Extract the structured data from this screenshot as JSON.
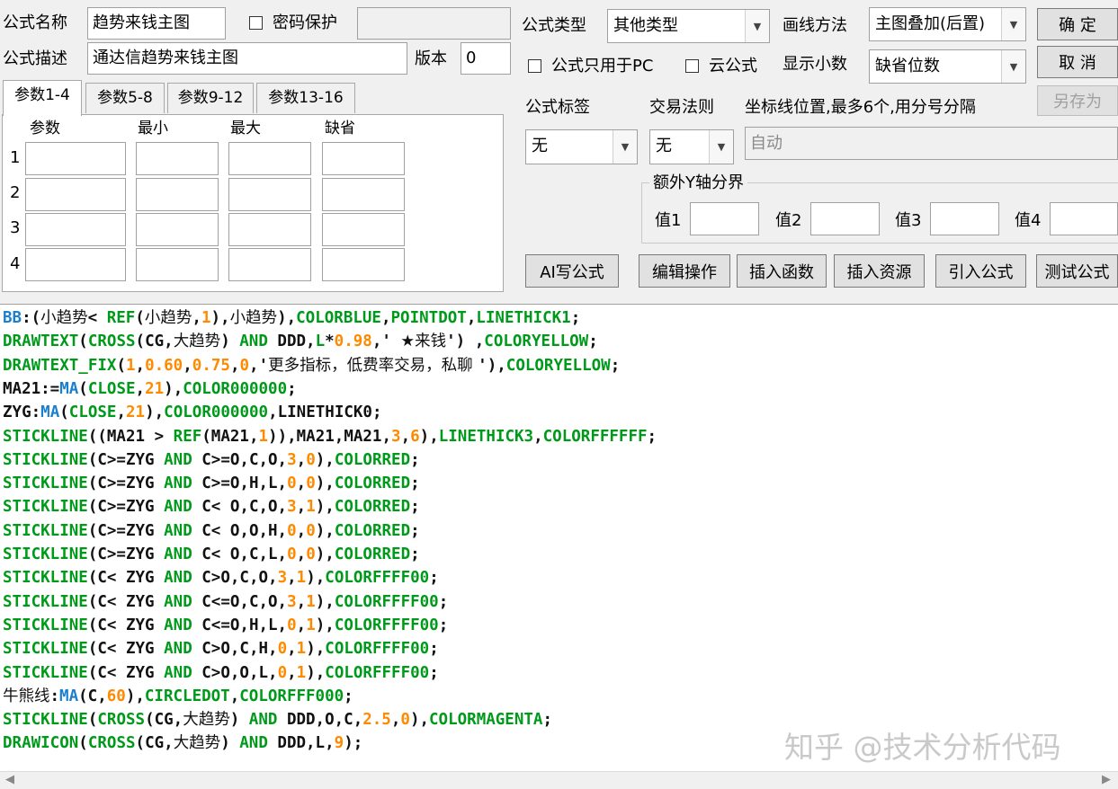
{
  "header": {
    "name_label": "公式名称",
    "name_value": "趋势来钱主图",
    "password_label": "密码保护",
    "desc_label": "公式描述",
    "desc_value": "通达信趋势来钱主图",
    "version_label": "版本",
    "version_value": "0",
    "type_label": "公式类型",
    "type_value": "其他类型",
    "draw_label": "画线方法",
    "draw_value": "主图叠加(后置)",
    "pc_only_label": "公式只用于PC",
    "cloud_label": "云公式",
    "decimal_label": "显示小数",
    "decimal_value": "缺省位数"
  },
  "buttons": {
    "ok": "确  定",
    "cancel": "取  消",
    "save_as": "另存为",
    "ai": "AI写公式",
    "edit": "编辑操作",
    "insert_func": "插入函数",
    "insert_res": "插入资源",
    "import": "引入公式",
    "test": "测试公式"
  },
  "tabs": [
    "参数1-4",
    "参数5-8",
    "参数9-12",
    "参数13-16"
  ],
  "params": {
    "headers": [
      "参数",
      "最小",
      "最大",
      "缺省"
    ],
    "rows": [
      "1",
      "2",
      "3",
      "4"
    ]
  },
  "tags": {
    "tag_label": "公式标签",
    "tag_value": "无",
    "trade_label": "交易法则",
    "trade_value": "无",
    "coord_label": "坐标线位置,最多6个,用分号分隔",
    "coord_value": "自动",
    "yaxis_group": "额外Y轴分界",
    "yvals": [
      "值1",
      "值2",
      "值3",
      "值4"
    ]
  },
  "watermark": "知乎 @技术分析代码",
  "code_lines": [
    [
      [
        "k-blue",
        "BB"
      ],
      [
        "k-black",
        ":("
      ],
      [
        "k-cn",
        "小趋势"
      ],
      [
        "k-black",
        "< "
      ],
      [
        "k-green",
        "REF"
      ],
      [
        "k-black",
        "("
      ],
      [
        "k-cn",
        "小趋势"
      ],
      [
        "k-black",
        ","
      ],
      [
        "k-orange",
        "1"
      ],
      [
        "k-black",
        "),"
      ],
      [
        "k-cn",
        "小趋势"
      ],
      [
        "k-black",
        "),"
      ],
      [
        "k-green",
        "COLORBLUE"
      ],
      [
        "k-black",
        ","
      ],
      [
        "k-green",
        "POINTDOT"
      ],
      [
        "k-black",
        ","
      ],
      [
        "k-green",
        "LINETHICK1"
      ],
      [
        "k-black",
        ";"
      ]
    ],
    [
      [
        "k-green",
        "DRAWTEXT"
      ],
      [
        "k-black",
        "("
      ],
      [
        "k-green",
        "CROSS"
      ],
      [
        "k-black",
        "(CG,"
      ],
      [
        "k-cn",
        "大趋势"
      ],
      [
        "k-black",
        ") "
      ],
      [
        "k-green",
        "AND"
      ],
      [
        "k-black",
        " DDD,"
      ],
      [
        "k-green",
        "L"
      ],
      [
        "k-black",
        "*"
      ],
      [
        "k-orange",
        "0.98"
      ],
      [
        "k-black",
        ",' "
      ],
      [
        "k-cn",
        "★来钱"
      ],
      [
        "k-black",
        "') ,"
      ],
      [
        "k-green",
        "COLORYELLOW"
      ],
      [
        "k-black",
        ";"
      ]
    ],
    [
      [
        "k-green",
        "DRAWTEXT_FIX"
      ],
      [
        "k-black",
        "("
      ],
      [
        "k-orange",
        "1"
      ],
      [
        "k-black",
        ","
      ],
      [
        "k-orange",
        "0.60"
      ],
      [
        "k-black",
        ","
      ],
      [
        "k-orange",
        "0.75"
      ],
      [
        "k-black",
        ","
      ],
      [
        "k-orange",
        "0"
      ],
      [
        "k-black",
        ",'"
      ],
      [
        "k-cn",
        "更多指标，低费率交易，私聊 "
      ],
      [
        "k-black",
        "'),"
      ],
      [
        "k-green",
        "COLORYELLOW"
      ],
      [
        "k-black",
        ";"
      ]
    ],
    [
      [
        "k-black",
        "MA21:="
      ],
      [
        "k-blue",
        "MA"
      ],
      [
        "k-black",
        "("
      ],
      [
        "k-green",
        "CLOSE"
      ],
      [
        "k-black",
        ","
      ],
      [
        "k-orange",
        "21"
      ],
      [
        "k-black",
        "),"
      ],
      [
        "k-green",
        "COLOR000000"
      ],
      [
        "k-black",
        ";"
      ]
    ],
    [
      [
        "k-black",
        "ZYG:"
      ],
      [
        "k-blue",
        "MA"
      ],
      [
        "k-black",
        "("
      ],
      [
        "k-green",
        "CLOSE"
      ],
      [
        "k-black",
        ","
      ],
      [
        "k-orange",
        "21"
      ],
      [
        "k-black",
        "),"
      ],
      [
        "k-green",
        "COLOR000000"
      ],
      [
        "k-black",
        ",LINETHICK0;"
      ]
    ],
    [
      [
        "k-green",
        "STICKLINE"
      ],
      [
        "k-black",
        "((MA21 > "
      ],
      [
        "k-green",
        "REF"
      ],
      [
        "k-black",
        "(MA21,"
      ],
      [
        "k-orange",
        "1"
      ],
      [
        "k-black",
        "))"
      ],
      [
        "k-black",
        ",MA21,MA21,"
      ],
      [
        "k-orange",
        "3"
      ],
      [
        "k-black",
        ","
      ],
      [
        "k-orange",
        "6"
      ],
      [
        "k-black",
        "),"
      ],
      [
        "k-green",
        "LINETHICK3"
      ],
      [
        "k-black",
        ","
      ],
      [
        "k-green",
        "COLORFFFFFF"
      ],
      [
        "k-black",
        ";"
      ]
    ],
    [
      [
        "k-green",
        "STICKLINE"
      ],
      [
        "k-black",
        "(C>=ZYG "
      ],
      [
        "k-green",
        "AND"
      ],
      [
        "k-black",
        " C>=O,C,O,"
      ],
      [
        "k-orange",
        "3"
      ],
      [
        "k-black",
        ","
      ],
      [
        "k-orange",
        "0"
      ],
      [
        "k-black",
        "),"
      ],
      [
        "k-green",
        "COLORRED"
      ],
      [
        "k-black",
        ";"
      ]
    ],
    [
      [
        "k-green",
        "STICKLINE"
      ],
      [
        "k-black",
        "(C>=ZYG "
      ],
      [
        "k-green",
        "AND"
      ],
      [
        "k-black",
        " C>=O,H,L,"
      ],
      [
        "k-orange",
        "0"
      ],
      [
        "k-black",
        ","
      ],
      [
        "k-orange",
        "0"
      ],
      [
        "k-black",
        "),"
      ],
      [
        "k-green",
        "COLORRED"
      ],
      [
        "k-black",
        ";"
      ]
    ],
    [
      [
        "k-green",
        "STICKLINE"
      ],
      [
        "k-black",
        "(C>=ZYG "
      ],
      [
        "k-green",
        "AND"
      ],
      [
        "k-black",
        " C< O,C,O,"
      ],
      [
        "k-orange",
        "3"
      ],
      [
        "k-black",
        ","
      ],
      [
        "k-orange",
        "1"
      ],
      [
        "k-black",
        "),"
      ],
      [
        "k-green",
        "COLORRED"
      ],
      [
        "k-black",
        ";"
      ]
    ],
    [
      [
        "k-green",
        "STICKLINE"
      ],
      [
        "k-black",
        "(C>=ZYG "
      ],
      [
        "k-green",
        "AND"
      ],
      [
        "k-black",
        " C< O,O,H,"
      ],
      [
        "k-orange",
        "0"
      ],
      [
        "k-black",
        ","
      ],
      [
        "k-orange",
        "0"
      ],
      [
        "k-black",
        "),"
      ],
      [
        "k-green",
        "COLORRED"
      ],
      [
        "k-black",
        ";"
      ]
    ],
    [
      [
        "k-green",
        "STICKLINE"
      ],
      [
        "k-black",
        "(C>=ZYG "
      ],
      [
        "k-green",
        "AND"
      ],
      [
        "k-black",
        " C< O,C,L,"
      ],
      [
        "k-orange",
        "0"
      ],
      [
        "k-black",
        ","
      ],
      [
        "k-orange",
        "0"
      ],
      [
        "k-black",
        "),"
      ],
      [
        "k-green",
        "COLORRED"
      ],
      [
        "k-black",
        ";"
      ]
    ],
    [
      [
        "k-green",
        "STICKLINE"
      ],
      [
        "k-black",
        "(C< ZYG "
      ],
      [
        "k-green",
        "AND"
      ],
      [
        "k-black",
        " C>O,C,O,"
      ],
      [
        "k-orange",
        "3"
      ],
      [
        "k-black",
        ","
      ],
      [
        "k-orange",
        "1"
      ],
      [
        "k-black",
        "),"
      ],
      [
        "k-green",
        "COLORFFFF00"
      ],
      [
        "k-black",
        ";"
      ]
    ],
    [
      [
        "k-green",
        "STICKLINE"
      ],
      [
        "k-black",
        "(C< ZYG "
      ],
      [
        "k-green",
        "AND"
      ],
      [
        "k-black",
        " C<=O,C,O,"
      ],
      [
        "k-orange",
        "3"
      ],
      [
        "k-black",
        ","
      ],
      [
        "k-orange",
        "1"
      ],
      [
        "k-black",
        "),"
      ],
      [
        "k-green",
        "COLORFFFF00"
      ],
      [
        "k-black",
        ";"
      ]
    ],
    [
      [
        "k-green",
        "STICKLINE"
      ],
      [
        "k-black",
        "(C< ZYG "
      ],
      [
        "k-green",
        "AND"
      ],
      [
        "k-black",
        " C<=O,H,L,"
      ],
      [
        "k-orange",
        "0"
      ],
      [
        "k-black",
        ","
      ],
      [
        "k-orange",
        "1"
      ],
      [
        "k-black",
        "),"
      ],
      [
        "k-green",
        "COLORFFFF00"
      ],
      [
        "k-black",
        ";"
      ]
    ],
    [
      [
        "k-green",
        "STICKLINE"
      ],
      [
        "k-black",
        "(C< ZYG "
      ],
      [
        "k-green",
        "AND"
      ],
      [
        "k-black",
        " C>O,C,H,"
      ],
      [
        "k-orange",
        "0"
      ],
      [
        "k-black",
        ","
      ],
      [
        "k-orange",
        "1"
      ],
      [
        "k-black",
        "),"
      ],
      [
        "k-green",
        "COLORFFFF00"
      ],
      [
        "k-black",
        ";"
      ]
    ],
    [
      [
        "k-green",
        "STICKLINE"
      ],
      [
        "k-black",
        "(C< ZYG "
      ],
      [
        "k-green",
        "AND"
      ],
      [
        "k-black",
        " C>O,O,L,"
      ],
      [
        "k-orange",
        "0"
      ],
      [
        "k-black",
        ","
      ],
      [
        "k-orange",
        "1"
      ],
      [
        "k-black",
        "),"
      ],
      [
        "k-green",
        "COLORFFFF00"
      ],
      [
        "k-black",
        ";"
      ]
    ],
    [
      [
        "k-cn",
        "牛熊线"
      ],
      [
        "k-black",
        ":"
      ],
      [
        "k-blue",
        "MA"
      ],
      [
        "k-black",
        "(C,"
      ],
      [
        "k-orange",
        "60"
      ],
      [
        "k-black",
        "),"
      ],
      [
        "k-green",
        "CIRCLEDOT"
      ],
      [
        "k-black",
        ","
      ],
      [
        "k-green",
        "COLORFFF000"
      ],
      [
        "k-black",
        ";"
      ]
    ],
    [
      [
        "k-green",
        "STICKLINE"
      ],
      [
        "k-black",
        "("
      ],
      [
        "k-green",
        "CROSS"
      ],
      [
        "k-black",
        "(CG,"
      ],
      [
        "k-cn",
        "大趋势"
      ],
      [
        "k-black",
        ") "
      ],
      [
        "k-green",
        "AND"
      ],
      [
        "k-black",
        " DDD,O,C,"
      ],
      [
        "k-orange",
        "2.5"
      ],
      [
        "k-black",
        ","
      ],
      [
        "k-orange",
        "0"
      ],
      [
        "k-black",
        "),"
      ],
      [
        "k-green",
        "COLORMAGENTA"
      ],
      [
        "k-black",
        ";"
      ]
    ],
    [
      [
        "k-green",
        "DRAWICON"
      ],
      [
        "k-black",
        "("
      ],
      [
        "k-green",
        "CROSS"
      ],
      [
        "k-black",
        "(CG,"
      ],
      [
        "k-cn",
        "大趋势"
      ],
      [
        "k-black",
        ") "
      ],
      [
        "k-green",
        "AND"
      ],
      [
        "k-black",
        " DDD,L,"
      ],
      [
        "k-orange",
        "9"
      ],
      [
        "k-black",
        ");"
      ]
    ]
  ]
}
